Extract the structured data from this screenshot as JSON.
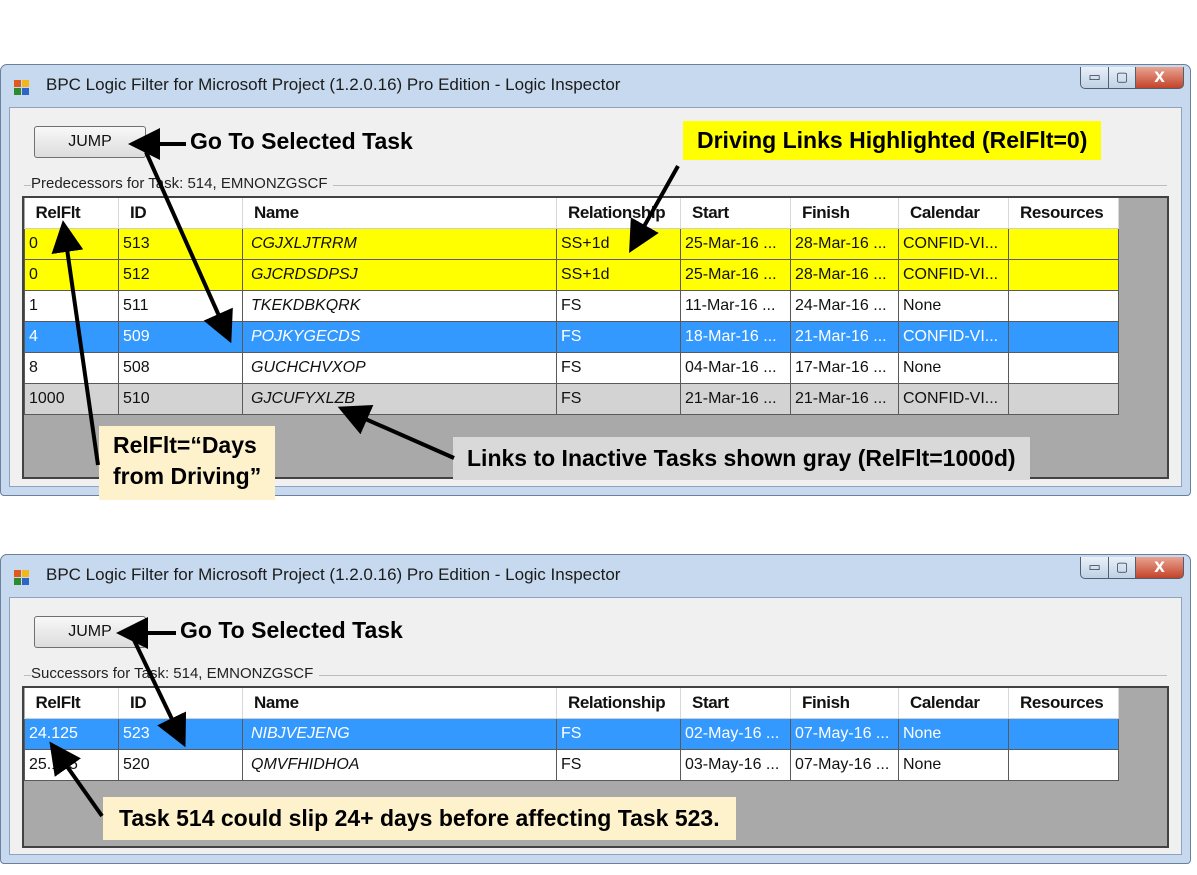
{
  "window_title": "BPC Logic Filter for Microsoft Project  (1.2.0.16)  Pro Edition - Logic Inspector",
  "window_controls": {
    "minimize": "▭",
    "maximize": "▢",
    "close": "X"
  },
  "columns": [
    "RelFlt",
    "ID",
    "Name",
    "Relationship",
    "Start",
    "Finish",
    "Calendar",
    "Resources"
  ],
  "predecessors": {
    "jump_label": "JUMP",
    "group_label": "Predecessors for Task: 514, EMNONZGSCF",
    "rows": [
      {
        "style": "driving",
        "relflt": "0",
        "id": "513",
        "name": "CGJXLJTRRM",
        "relationship": "SS+1d",
        "start": "25-Mar-16 ...",
        "finish": "28-Mar-16 ...",
        "calendar": "CONFID-VI...",
        "resources": ""
      },
      {
        "style": "driving",
        "relflt": "0",
        "id": "512",
        "name": "GJCRDSDPSJ",
        "relationship": "SS+1d",
        "start": "25-Mar-16 ...",
        "finish": "28-Mar-16 ...",
        "calendar": "CONFID-VI...",
        "resources": ""
      },
      {
        "style": "normal",
        "relflt": "1",
        "id": "511",
        "name": "TKEKDBKQRK",
        "relationship": "FS",
        "start": "11-Mar-16 ...",
        "finish": "24-Mar-16 ...",
        "calendar": "None",
        "resources": ""
      },
      {
        "style": "selected",
        "relflt": "4",
        "id": "509",
        "name": "POJKYGECDS",
        "relationship": "FS",
        "start": "18-Mar-16 ...",
        "finish": "21-Mar-16 ...",
        "calendar": "CONFID-VI...",
        "resources": ""
      },
      {
        "style": "normal",
        "relflt": "8",
        "id": "508",
        "name": "GUCHCHVXOP",
        "relationship": "FS",
        "start": "04-Mar-16 ...",
        "finish": "17-Mar-16 ...",
        "calendar": "None",
        "resources": ""
      },
      {
        "style": "inactive",
        "relflt": "1000",
        "id": "510",
        "name": "GJCUFYXLZB",
        "relationship": "FS",
        "start": "21-Mar-16 ...",
        "finish": "21-Mar-16 ...",
        "calendar": "CONFID-VI...",
        "resources": ""
      }
    ]
  },
  "successors": {
    "jump_label": "JUMP",
    "group_label": "Successors for Task: 514, EMNONZGSCF",
    "rows": [
      {
        "style": "selected",
        "relflt": "24.125",
        "id": "523",
        "name": "NIBJVEJENG",
        "relationship": "FS",
        "start": "02-May-16 ...",
        "finish": "07-May-16 ...",
        "calendar": "None",
        "resources": ""
      },
      {
        "style": "normal",
        "relflt": "25.125",
        "id": "520",
        "name": "QMVFHIDHOA",
        "relationship": "FS",
        "start": "03-May-16 ...",
        "finish": "07-May-16 ...",
        "calendar": "None",
        "resources": ""
      }
    ]
  },
  "callouts": {
    "goto_top": "Go To Selected Task",
    "driving": "Driving Links Highlighted (RelFlt=0)",
    "relflt_line1": "RelFlt=“Days",
    "relflt_line2": "from Driving”",
    "inactive": "Links to Inactive Tasks shown gray (RelFlt=1000d)",
    "goto_bottom": "Go To Selected Task",
    "slip": "Task 514 could slip 24+ days before affecting Task 523."
  },
  "colors": {
    "driving_row": "#ffff00",
    "selected_row": "#3399ff",
    "inactive_row": "#d3d3d3",
    "callout_yellow": "#ffff00",
    "callout_peach": "#fef2cc",
    "callout_gray": "#d9d9d9"
  }
}
